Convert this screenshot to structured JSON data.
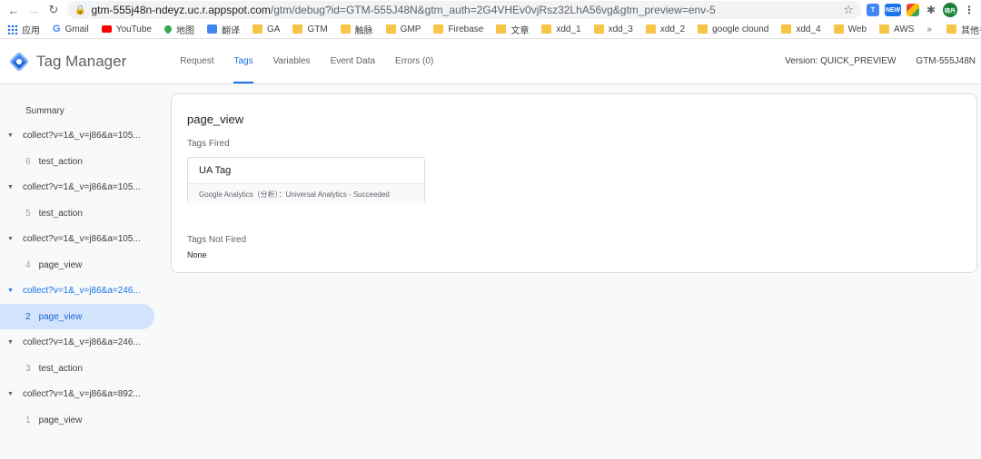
{
  "browser": {
    "url_host": "gtm-555j48n-ndeyz.uc.r.appspot.com",
    "url_path": "/gtm/debug?id=GTM-555J48N&gtm_auth=2G4VHEv0vjRsz32LhA56vg&gtm_preview=env-5",
    "ext_new_label": "NEW",
    "profile_label": "晓丹"
  },
  "bookmarks": {
    "items": [
      {
        "label": "应用",
        "icon": "apps-grid-icon"
      },
      {
        "label": "Gmail",
        "icon": "google-icon"
      },
      {
        "label": "YouTube",
        "icon": "youtube-icon"
      },
      {
        "label": "地图",
        "icon": "maps-icon"
      },
      {
        "label": "翻译",
        "icon": "translate-icon"
      },
      {
        "label": "GA",
        "icon": "folder-icon"
      },
      {
        "label": "GTM",
        "icon": "folder-icon"
      },
      {
        "label": "触脉",
        "icon": "folder-icon"
      },
      {
        "label": "GMP",
        "icon": "folder-icon"
      },
      {
        "label": "Firebase",
        "icon": "folder-icon"
      },
      {
        "label": "文章",
        "icon": "folder-icon"
      },
      {
        "label": "xdd_1",
        "icon": "folder-icon"
      },
      {
        "label": "xdd_3",
        "icon": "folder-icon"
      },
      {
        "label": "xdd_2",
        "icon": "folder-icon"
      },
      {
        "label": "google clound",
        "icon": "folder-icon"
      },
      {
        "label": "xdd_4",
        "icon": "folder-icon"
      },
      {
        "label": "Web",
        "icon": "folder-icon"
      },
      {
        "label": "AWS",
        "icon": "folder-icon"
      }
    ],
    "more": "»",
    "other": "其他书签"
  },
  "header": {
    "title": "Tag Manager",
    "tabs": [
      "Request",
      "Tags",
      "Variables",
      "Event Data",
      "Errors (0)"
    ],
    "active_tab": "Tags",
    "version": "Version: QUICK_PREVIEW",
    "container_id": "GTM-555J48N"
  },
  "sidebar": {
    "summary": "Summary",
    "groups": [
      {
        "label": "collect?v=1&_v=j86&a=105...",
        "child_num": "6",
        "child_label": "test_action"
      },
      {
        "label": "collect?v=1&_v=j86&a=105...",
        "child_num": "5",
        "child_label": "test_action"
      },
      {
        "label": "collect?v=1&_v=j86&a=105...",
        "child_num": "4",
        "child_label": "page_view"
      },
      {
        "label": "collect?v=1&_v=j86&a=246...",
        "child_num": "2",
        "child_label": "page_view"
      },
      {
        "label": "collect?v=1&_v=j86&a=246...",
        "child_num": "3",
        "child_label": "test_action"
      },
      {
        "label": "collect?v=1&_v=j86&a=892...",
        "child_num": "1",
        "child_label": "page_view"
      }
    ]
  },
  "main": {
    "title": "page_view",
    "fired_label": "Tags Fired",
    "fired_tag_name": "UA Tag",
    "fired_tag_status": "Google Analytics（分析）：Universal Analytics - Succeeded",
    "not_fired_label": "Tags Not Fired",
    "not_fired_value": "None"
  },
  "colors": {
    "accent": "#1a73e8",
    "selected_bg": "#d2e3fc"
  }
}
